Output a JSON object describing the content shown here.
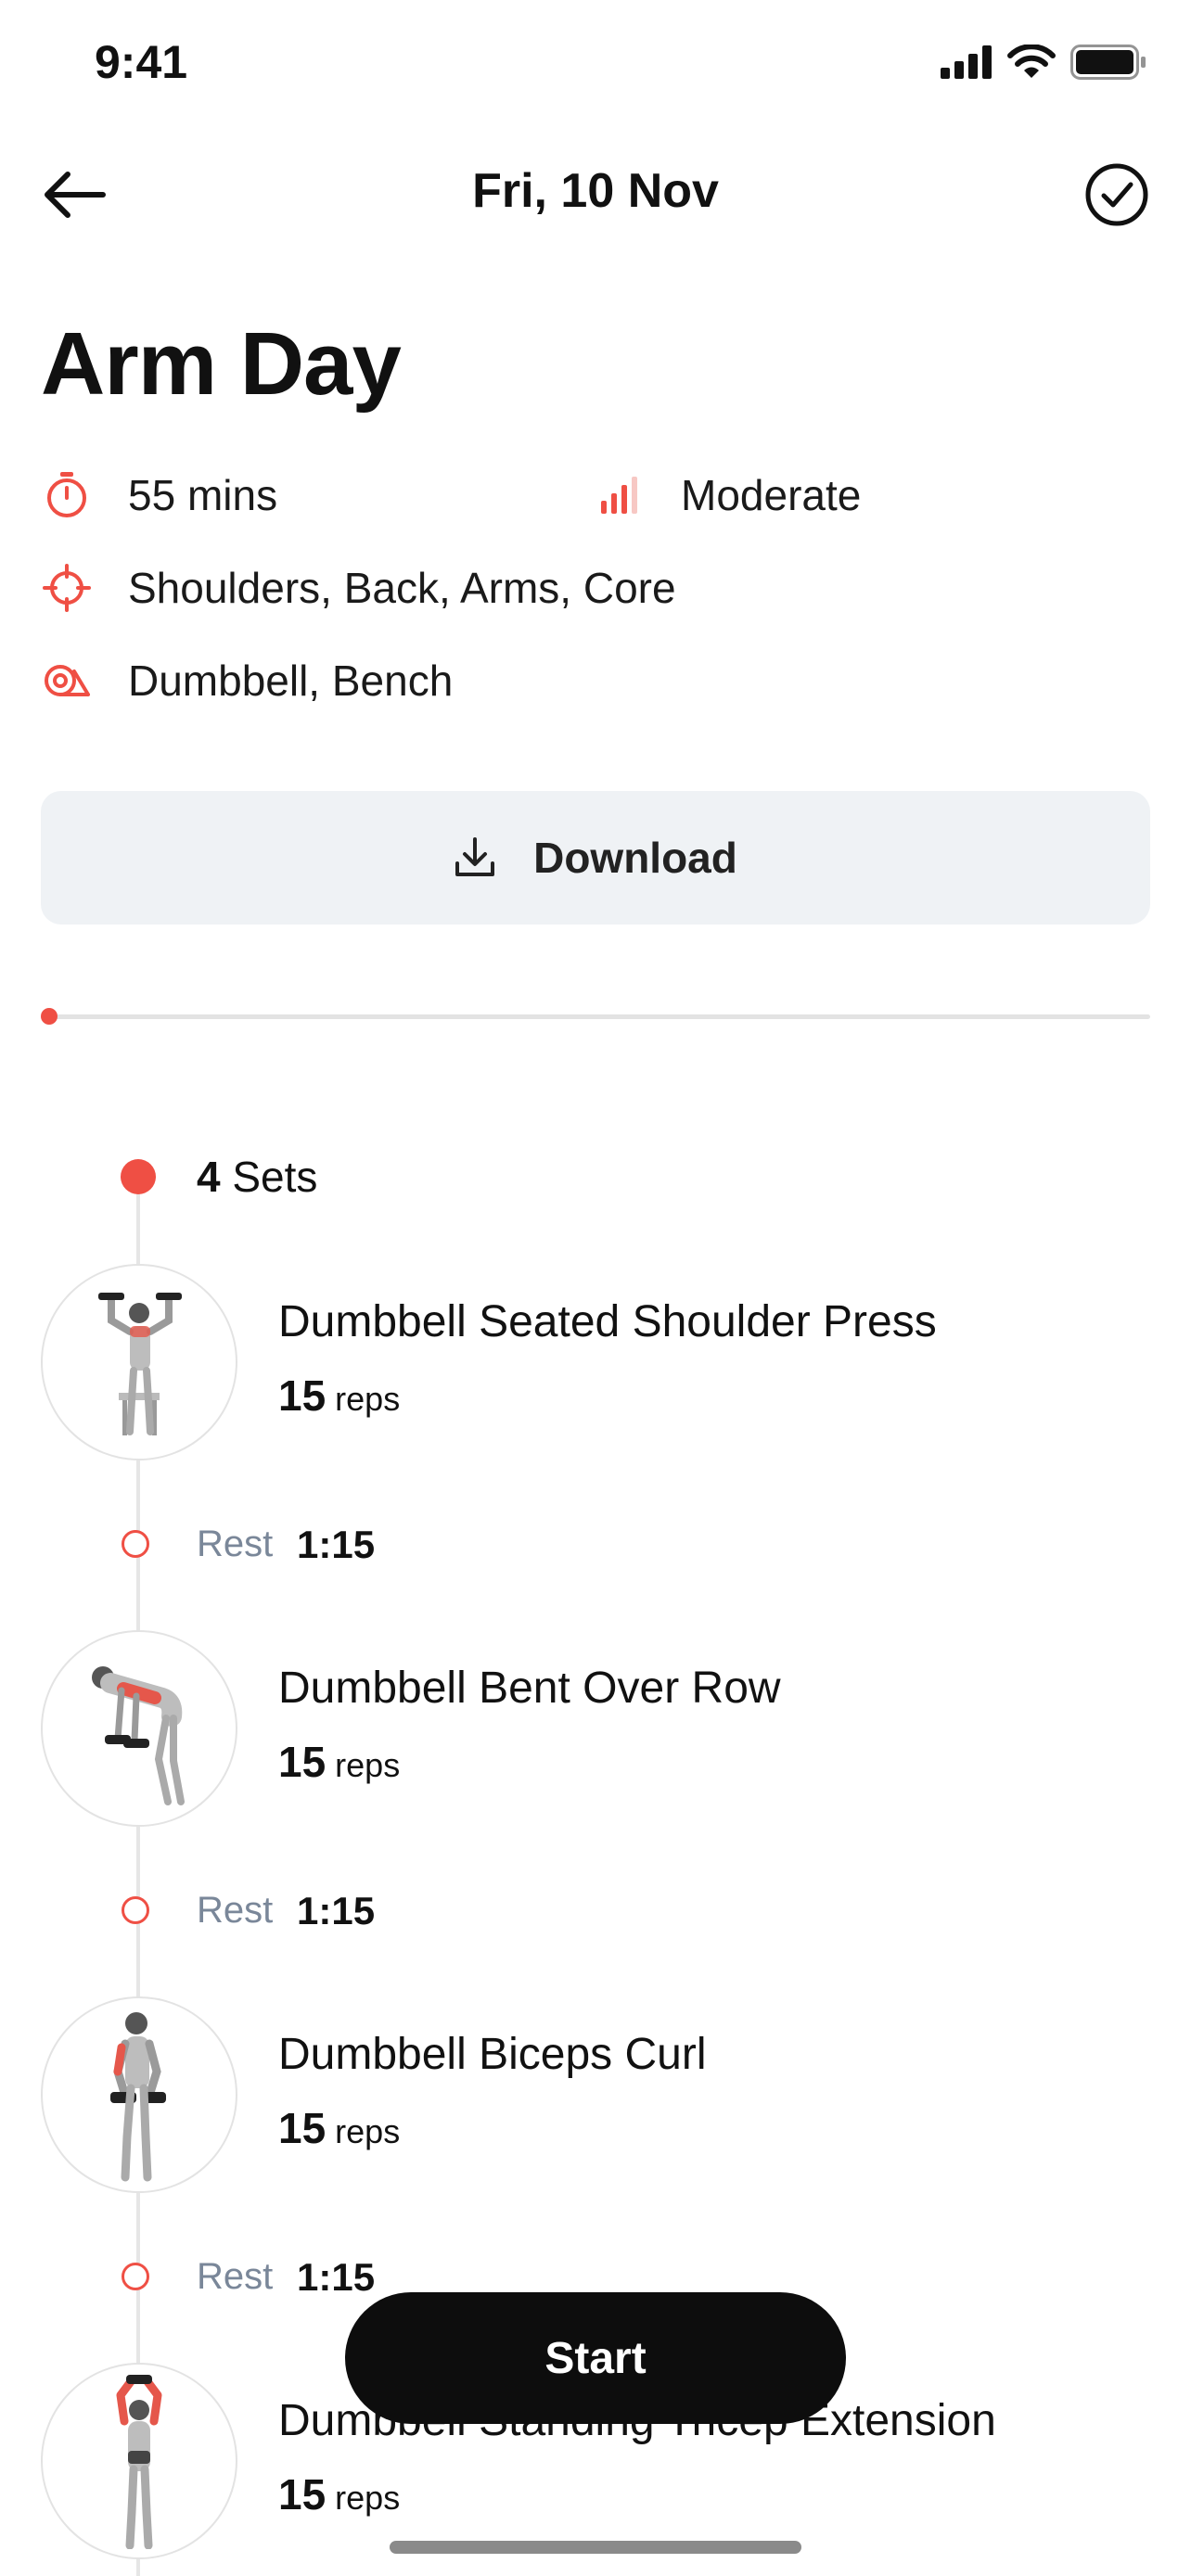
{
  "status_bar": {
    "time": "9:41"
  },
  "nav": {
    "title": "Fri, 10 Nov"
  },
  "workout": {
    "title": "Arm Day",
    "duration": "55 mins",
    "difficulty": "Moderate",
    "muscles": "Shoulders, Back, Arms, Core",
    "equipment": "Dumbbell, Bench"
  },
  "download": {
    "label": "Download"
  },
  "progress": {
    "value": 0
  },
  "sets": {
    "count": "4",
    "label": "Sets"
  },
  "exercises": [
    {
      "name": "Dumbbell Seated Shoulder Press",
      "reps": "15",
      "unit": "reps"
    },
    {
      "name": "Dumbbell Bent Over Row",
      "reps": "15",
      "unit": "reps"
    },
    {
      "name": "Dumbbell Biceps Curl",
      "reps": "15",
      "unit": "reps"
    },
    {
      "name": "Dumbbell Standing Tricep Extension",
      "reps": "15",
      "unit": "reps"
    }
  ],
  "rests": [
    {
      "label": "Rest",
      "time": "1:15"
    },
    {
      "label": "Rest",
      "time": "1:15"
    },
    {
      "label": "Rest",
      "time": "1:15"
    }
  ],
  "start": {
    "label": "Start"
  },
  "colors": {
    "accent": "#ef4f44",
    "muted": "#7a8799",
    "button_bg": "#eff2f5",
    "primary_dark": "#0d0d0d"
  },
  "icons": {
    "back": "arrow-left-icon",
    "done": "check-circle-icon",
    "duration": "stopwatch-icon",
    "difficulty": "signal-bars-icon",
    "muscles": "target-icon",
    "equipment": "mat-icon",
    "download": "download-icon"
  }
}
